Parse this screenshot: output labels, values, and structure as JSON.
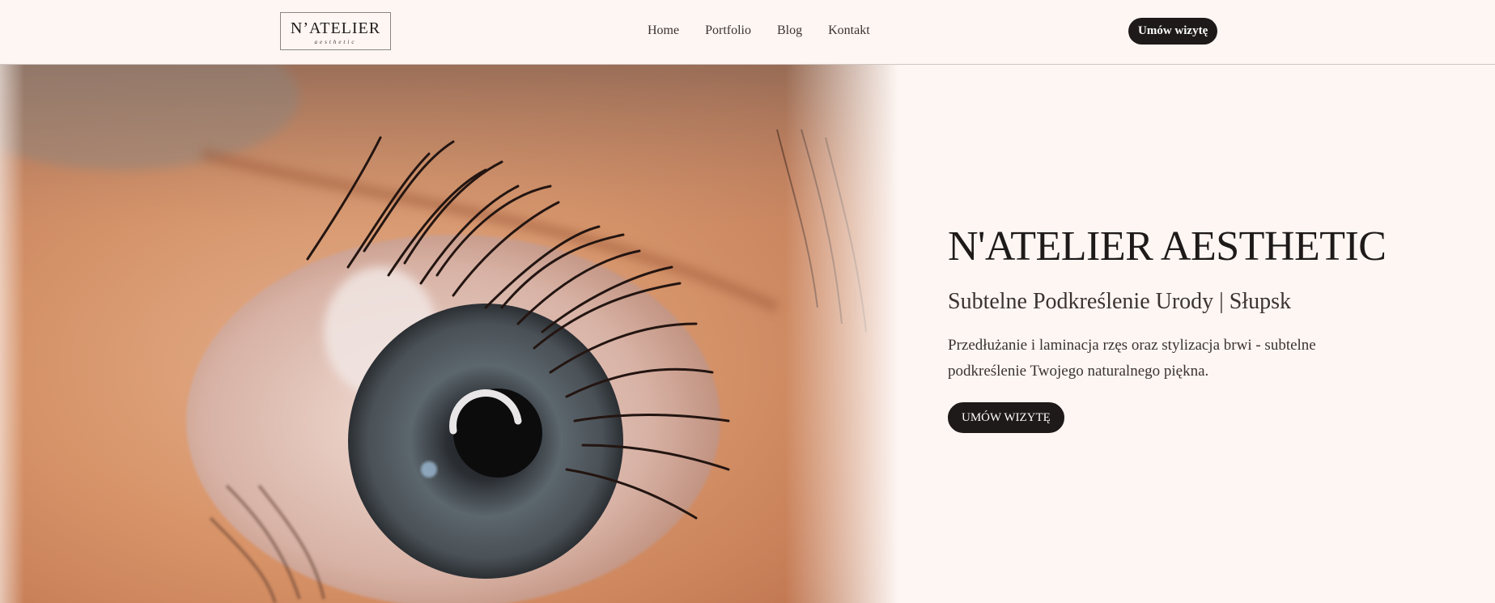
{
  "header": {
    "logo_main": "N’ATELIER",
    "logo_sub": "aesthetic",
    "nav": [
      {
        "label": "Home"
      },
      {
        "label": "Portfolio"
      },
      {
        "label": "Blog"
      },
      {
        "label": "Kontakt"
      }
    ],
    "cta_label": "Umów wizytę"
  },
  "hero": {
    "image_icon": "eye-lashes-photo",
    "title": "N'ATELIER AESTHETIC",
    "subtitle": "Subtelne Podkreślenie Urody | Słupsk",
    "description": "Przedłużanie i laminacja rzęs oraz stylizacja brwi - subtelne podkreślenie Twojego naturalnego piękna.",
    "cta_label": "UMÓW WIZYTĘ"
  },
  "colors": {
    "background": "#fdf6f3",
    "button": "#1e1a19",
    "text": "#2a2220"
  }
}
